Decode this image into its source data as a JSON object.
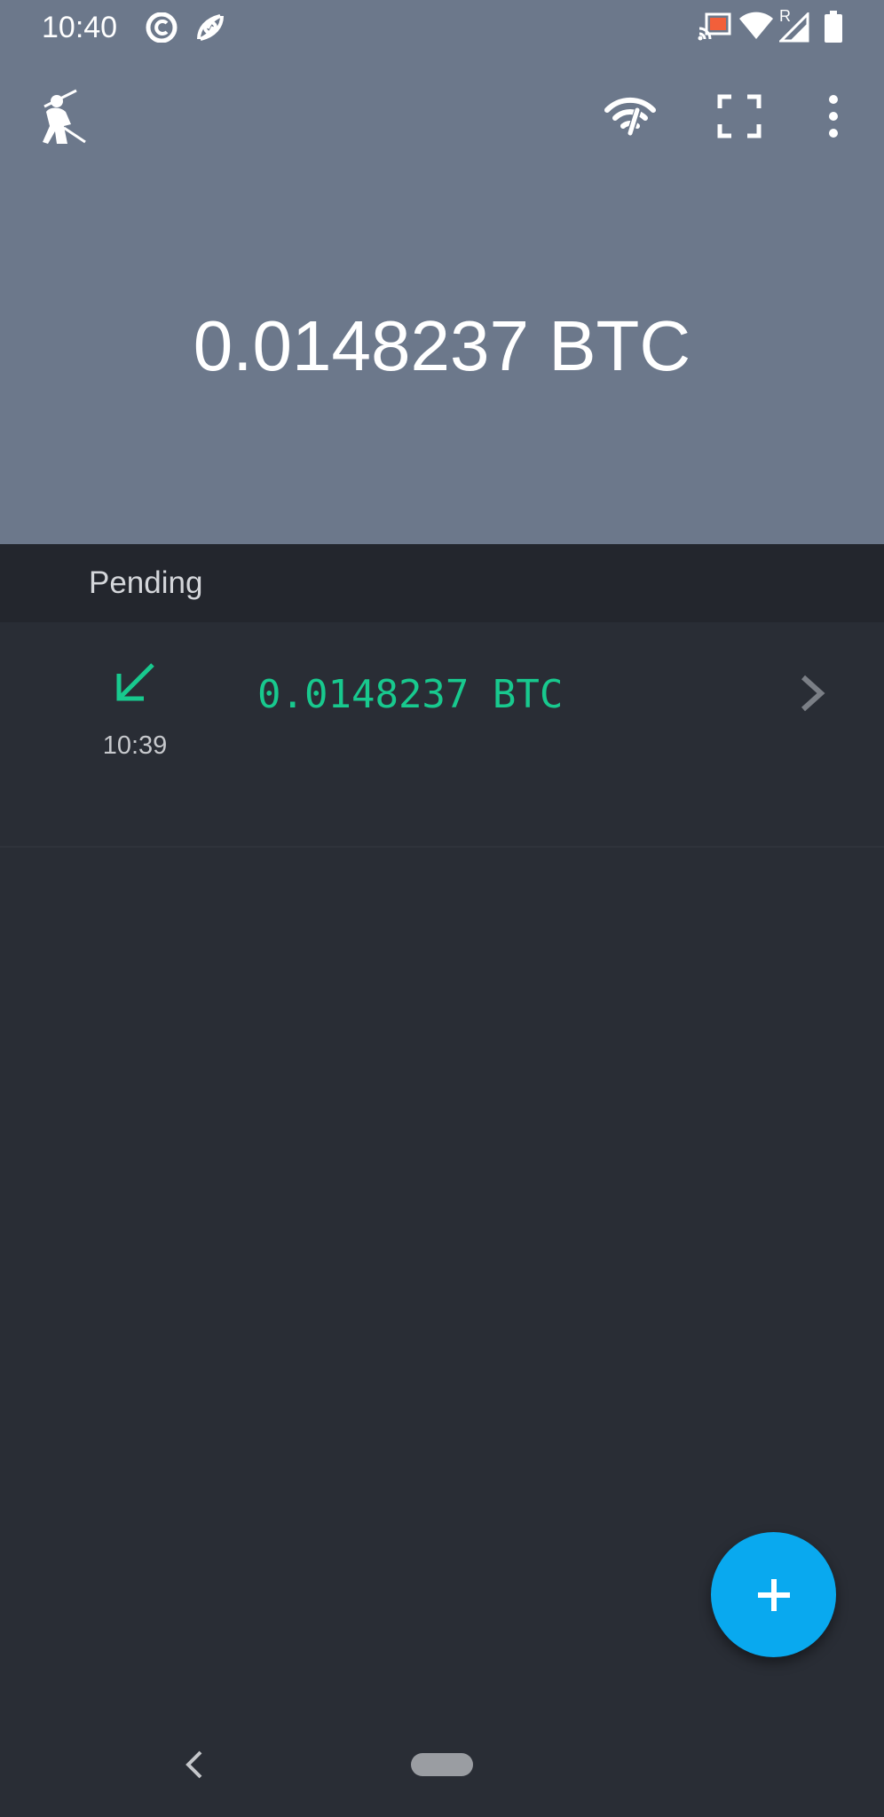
{
  "status_bar": {
    "time": "10:40",
    "icons": [
      "signal-app-icon",
      "hurricane-icon",
      "cast-icon",
      "wifi-icon",
      "cellular-roaming-icon",
      "battery-icon"
    ],
    "roaming_label": "R"
  },
  "toolbar": {
    "icons": [
      "samurai-logo-icon",
      "network-status-icon",
      "scan-qr-icon",
      "more-options-icon"
    ]
  },
  "balance": {
    "text": "0.0148237 BTC"
  },
  "transactions": {
    "section_title": "Pending",
    "items": [
      {
        "direction_icon": "arrow-incoming-icon",
        "time": "10:39",
        "amount": "0.0148237 BTC",
        "chevron_icon": "chevron-right-icon"
      }
    ]
  },
  "fab": {
    "icon": "plus-icon"
  },
  "nav": {
    "icons": [
      "back-icon",
      "home-pill"
    ]
  },
  "colors": {
    "header_bg": "#6c788b",
    "section_bg": "#23262d",
    "content_bg": "#292d35",
    "incoming_green": "#18c98e",
    "fab_blue": "#09a9ef"
  }
}
